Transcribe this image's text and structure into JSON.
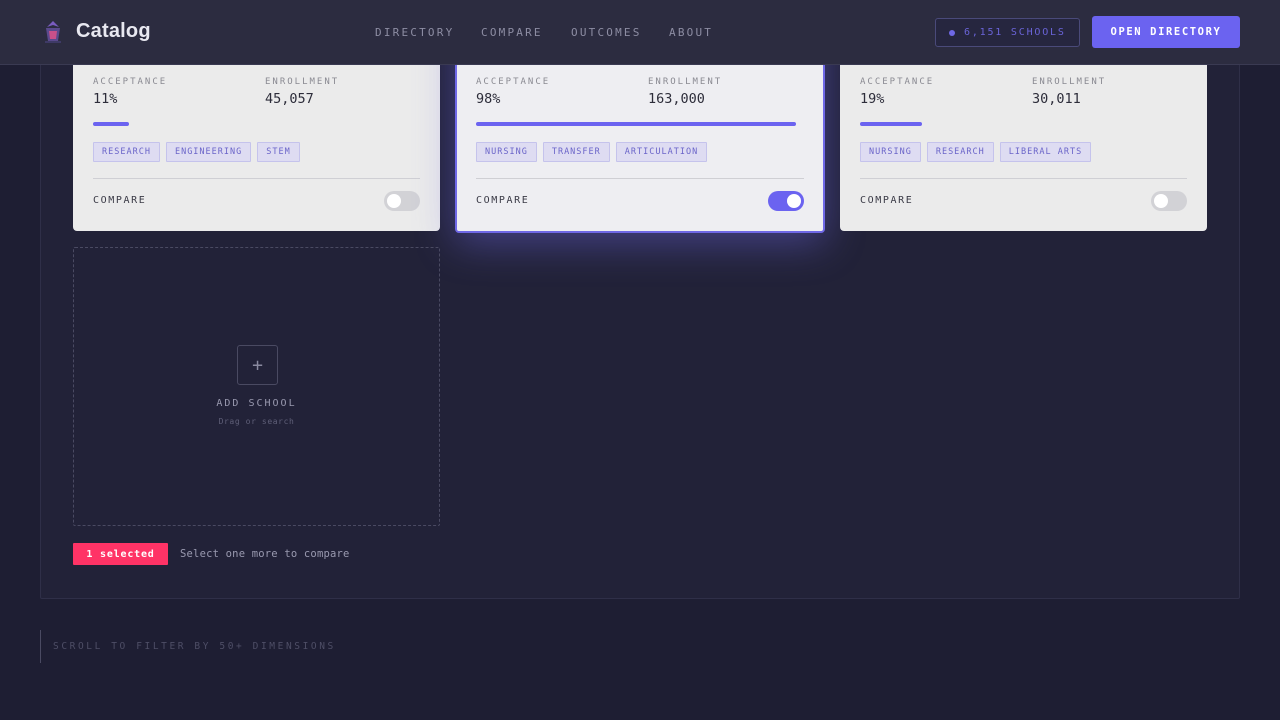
{
  "header": {
    "brand": "Catalog",
    "nav": [
      "DIRECTORY",
      "COMPARE",
      "OUTCOMES",
      "ABOUT"
    ],
    "badge": "6,151 SCHOOLS",
    "cta": "OPEN DIRECTORY"
  },
  "cards": [
    {
      "acceptance_label": "ACCEPTANCE",
      "acceptance": "11%",
      "acceptance_fraction": 0.11,
      "enrollment_label": "ENROLLMENT",
      "enrollment": "45,057",
      "tags": [
        "RESEARCH",
        "ENGINEERING",
        "STEM"
      ],
      "compare_label": "COMPARE",
      "compare_on": false
    },
    {
      "acceptance_label": "ACCEPTANCE",
      "acceptance": "98%",
      "acceptance_fraction": 0.98,
      "enrollment_label": "ENROLLMENT",
      "enrollment": "163,000",
      "tags": [
        "NURSING",
        "TRANSFER",
        "ARTICULATION"
      ],
      "compare_label": "COMPARE",
      "compare_on": true
    },
    {
      "acceptance_label": "ACCEPTANCE",
      "acceptance": "19%",
      "acceptance_fraction": 0.19,
      "enrollment_label": "ENROLLMENT",
      "enrollment": "30,011",
      "tags": [
        "NURSING",
        "RESEARCH",
        "LIBERAL ARTS"
      ],
      "compare_label": "COMPARE",
      "compare_on": false
    }
  ],
  "add_school": {
    "plus": "+",
    "title": "ADD SCHOOL",
    "subtitle": "Drag or search"
  },
  "selection": {
    "badge": "1 selected",
    "hint": "Select one more to compare"
  },
  "scroll_hint": "SCROLL TO FILTER BY 50+ DIMENSIONS",
  "colors": {
    "accent": "#6b63f0",
    "selected_badge": "#ff3366",
    "background": "#1e1e33"
  }
}
